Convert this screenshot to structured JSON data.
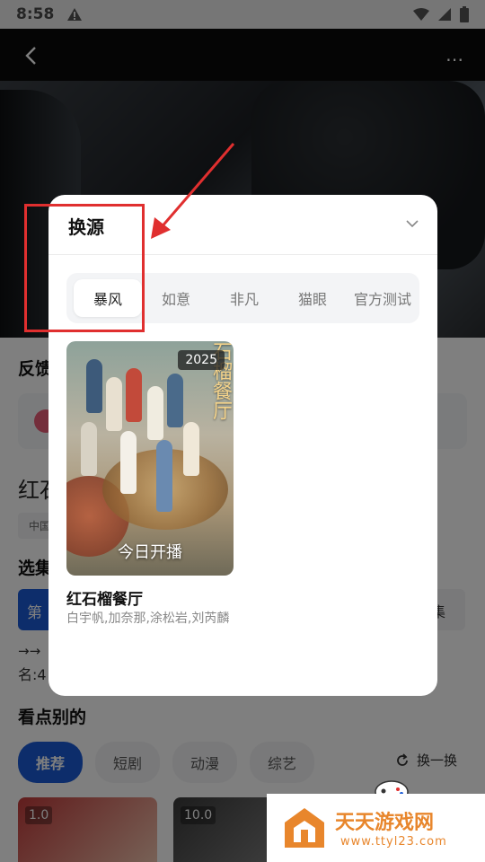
{
  "status_bar": {
    "time": "8:58"
  },
  "content": {
    "feedback_label": "反馈",
    "title_partial": "红石",
    "country_chip": "中国",
    "episodes_label": "选集",
    "episode_first": "第",
    "episode_last": "集",
    "arrows": "→→",
    "name_line": "名:4",
    "recommend_label": "看点别的",
    "categories": [
      "推荐",
      "短剧",
      "动漫",
      "综艺"
    ],
    "refresh_label": "换一换",
    "poster_scores": [
      "1.0",
      "10.0"
    ]
  },
  "modal": {
    "title": "换源",
    "tabs": [
      "暴风",
      "如意",
      "非凡",
      "猫眼",
      "官方测试"
    ],
    "active_tab": "暴风",
    "movie": {
      "vertical_title": "石榴餐厅",
      "year": "2025",
      "poster_tagline": "今日开播",
      "title": "红石榴餐厅",
      "cast": "白宇帆,加奈那,涂松岩,刘芮麟"
    }
  },
  "watermark": {
    "name": "天天游戏网",
    "url": "www.ttyl23.com"
  },
  "colors": {
    "accent": "#1a5bd6",
    "annotation": "#e02f2f",
    "watermark": "#e8862c"
  }
}
